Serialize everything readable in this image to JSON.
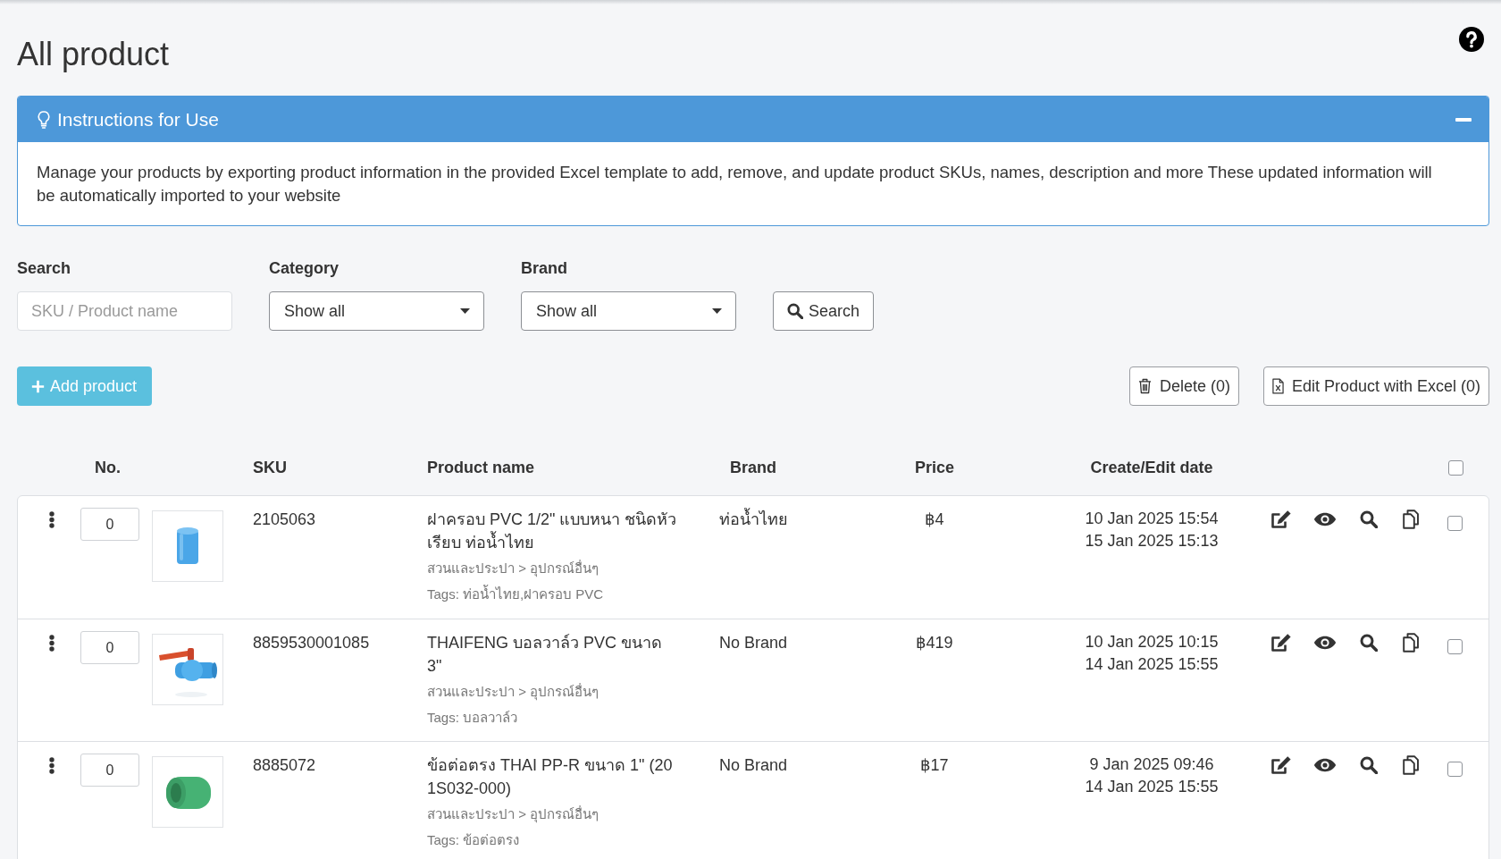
{
  "page": {
    "title": "All product"
  },
  "instructions": {
    "title": "Instructions for Use",
    "expanded": true,
    "text": "Manage your products by exporting product information in the provided Excel template to add, remove, and update product SKUs, names, description and more These updated information will be automatically imported to your website"
  },
  "filters": [
    {
      "kind": "text",
      "label": "Search",
      "placeholder": "SKU / Product name"
    },
    {
      "kind": "select",
      "label": "Category",
      "value": "Show all"
    },
    {
      "kind": "select",
      "label": "Brand",
      "value": "Show all"
    }
  ],
  "search_button": {
    "label": "Search"
  },
  "toolbar": {
    "add_button": {
      "label": "Add product"
    },
    "delete_button": {
      "label": "Delete (0)"
    },
    "excel_button": {
      "label": "Edit Product with Excel (0)"
    }
  },
  "table": {
    "columns": [
      {
        "label": "No."
      },
      {
        "label": "SKU"
      },
      {
        "label": "Product name"
      },
      {
        "label": "Brand"
      },
      {
        "label": "Price"
      },
      {
        "label": "Create/Edit date"
      }
    ],
    "select_all": {
      "checked": false
    },
    "rows": [
      {
        "quantity": "0",
        "photo": {
          "kind": "cap"
        },
        "sku": "2105063",
        "name": "ฝาครอบ PVC 1/2\" แบบหนา ชนิดหัวเรียบ ท่อน้ำไทย",
        "category": "สวนและประปา > อุปกรณ์อื่นๆ",
        "tags": "Tags: ท่อน้ำไทย,ฝาครอบ PVC",
        "brand": "ท่อน้ำไทย",
        "price": "฿4",
        "create_date": "10 Jan 2025 15:54",
        "edit_date": "15 Jan 2025 15:13",
        "checked": false
      },
      {
        "quantity": "0",
        "photo": {
          "kind": "valve"
        },
        "sku": "8859530001085",
        "name": "THAIFENG บอลวาล์ว PVC ขนาด 3\"",
        "category": "สวนและประปา > อุปกรณ์อื่นๆ",
        "tags": "Tags: บอลวาล์ว",
        "brand": "No Brand",
        "price": "฿419",
        "create_date": "10 Jan 2025 10:15",
        "edit_date": "14 Jan 2025 15:55",
        "checked": false
      },
      {
        "quantity": "0",
        "photo": {
          "kind": "coupler"
        },
        "sku": "8885072",
        "name": "ข้อต่อตรง THAI PP-R ขนาด 1\" (20 1S032-000)",
        "category": "สวนและประปา > อุปกรณ์อื่นๆ",
        "tags": "Tags: ข้อต่อตรง",
        "brand": "No Brand",
        "price": "฿17",
        "create_date": "9 Jan 2025 09:46",
        "edit_date": "14 Jan 2025 15:55",
        "checked": false
      }
    ]
  }
}
